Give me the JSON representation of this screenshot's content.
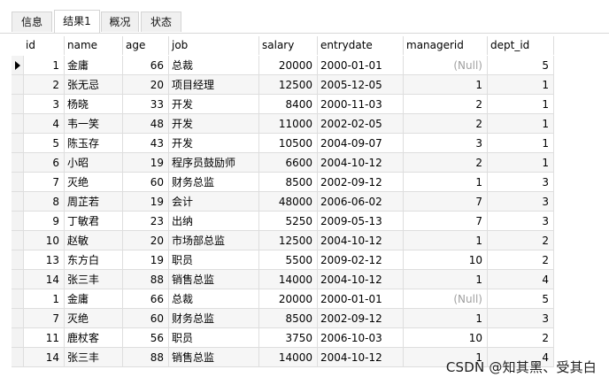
{
  "tabs": [
    {
      "label": "信息",
      "active": false
    },
    {
      "label": "结果1",
      "active": true
    },
    {
      "label": "概况",
      "active": false
    },
    {
      "label": "状态",
      "active": false
    }
  ],
  "columns": [
    "id",
    "name",
    "age",
    "job",
    "salary",
    "entrydate",
    "managerid",
    "dept_id"
  ],
  "rows": [
    [
      "1",
      "金庸",
      "66",
      "总裁",
      "20000",
      "2000-01-01",
      "(Null)",
      "5"
    ],
    [
      "2",
      "张无忌",
      "20",
      "项目经理",
      "12500",
      "2005-12-05",
      "1",
      "1"
    ],
    [
      "3",
      "杨晓",
      "33",
      "开发",
      "8400",
      "2000-11-03",
      "2",
      "1"
    ],
    [
      "4",
      "韦一笑",
      "48",
      "开发",
      "11000",
      "2002-02-05",
      "2",
      "1"
    ],
    [
      "5",
      "陈玉存",
      "43",
      "开发",
      "10500",
      "2004-09-07",
      "3",
      "1"
    ],
    [
      "6",
      "小昭",
      "19",
      "程序员鼓励师",
      "6600",
      "2004-10-12",
      "2",
      "1"
    ],
    [
      "7",
      "灭绝",
      "60",
      "财务总监",
      "8500",
      "2002-09-12",
      "1",
      "3"
    ],
    [
      "8",
      "周芷若",
      "19",
      "会计",
      "48000",
      "2006-06-02",
      "7",
      "3"
    ],
    [
      "9",
      "丁敏君",
      "23",
      "出纳",
      "5250",
      "2009-05-13",
      "7",
      "3"
    ],
    [
      "10",
      "赵敏",
      "20",
      "市场部总监",
      "12500",
      "2004-10-12",
      "1",
      "2"
    ],
    [
      "13",
      "东方白",
      "19",
      "职员",
      "5500",
      "2009-02-12",
      "10",
      "2"
    ],
    [
      "14",
      "张三丰",
      "88",
      "销售总监",
      "14000",
      "2004-10-12",
      "1",
      "4"
    ],
    [
      "1",
      "金庸",
      "66",
      "总裁",
      "20000",
      "2000-01-01",
      "(Null)",
      "5"
    ],
    [
      "7",
      "灭绝",
      "60",
      "财务总监",
      "8500",
      "2002-09-12",
      "1",
      "3"
    ],
    [
      "11",
      "鹿杖客",
      "56",
      "职员",
      "3750",
      "2006-10-03",
      "10",
      "2"
    ],
    [
      "14",
      "张三丰",
      "88",
      "销售总监",
      "14000",
      "2004-10-12",
      "1",
      "4"
    ]
  ],
  "current_row_index": 0,
  "watermark": "CSDN @知其黑、受其白"
}
